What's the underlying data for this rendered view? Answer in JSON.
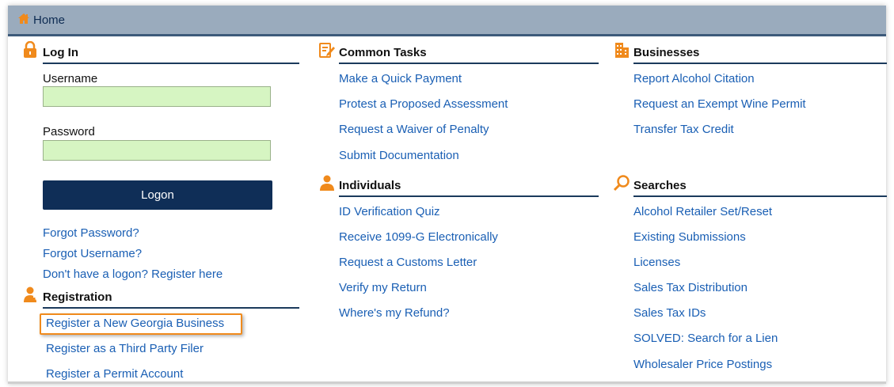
{
  "header": {
    "home_label": "Home"
  },
  "login": {
    "title": "Log In",
    "username_label": "Username",
    "username_value": "",
    "password_label": "Password",
    "password_value": "",
    "logon_button": "Logon",
    "links": [
      "Forgot Password?",
      "Forgot Username?",
      "Don't have a logon? Register here"
    ]
  },
  "registration": {
    "title": "Registration",
    "links": [
      "Register a New Georgia Business",
      "Register as a Third Party Filer",
      "Register a Permit Account"
    ]
  },
  "common_tasks": {
    "title": "Common Tasks",
    "links": [
      "Make a Quick Payment",
      "Protest a Proposed Assessment",
      "Request a Waiver of Penalty",
      "Submit Documentation"
    ]
  },
  "individuals": {
    "title": "Individuals",
    "links": [
      "ID Verification Quiz",
      "Receive 1099-G Electronically",
      "Request a Customs Letter",
      "Verify my Return",
      "Where's my Refund?"
    ]
  },
  "businesses": {
    "title": "Businesses",
    "links": [
      "Report Alcohol Citation",
      "Request an Exempt Wine Permit",
      "Transfer Tax Credit"
    ]
  },
  "searches": {
    "title": "Searches",
    "links": [
      "Alcohol Retailer Set/Reset",
      "Existing Submissions",
      "Licenses",
      "Sales Tax Distribution",
      "Sales Tax IDs",
      "SOLVED: Search for a Lien",
      "Wholesaler Price Postings"
    ]
  },
  "colors": {
    "accent": "#f08a1c",
    "link": "#1a5fb4",
    "nav": "#0f2e57",
    "topbar": "#9aabbd",
    "field": "#d6f5c2"
  }
}
